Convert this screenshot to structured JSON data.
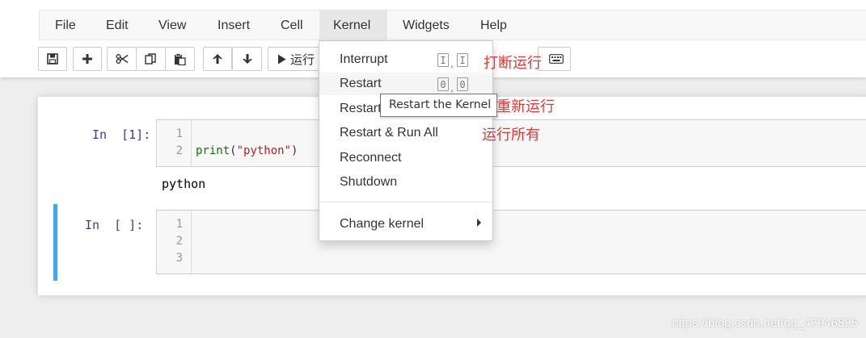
{
  "menubar": {
    "items": [
      {
        "label": "File"
      },
      {
        "label": "Edit"
      },
      {
        "label": "View"
      },
      {
        "label": "Insert"
      },
      {
        "label": "Cell"
      },
      {
        "label": "Kernel"
      },
      {
        "label": "Widgets"
      },
      {
        "label": "Help"
      }
    ],
    "active": "Kernel"
  },
  "toolbar": {
    "buttons": [
      {
        "icon": "save-icon"
      },
      {
        "icon": "plus-icon"
      },
      {
        "icon": "cut-icon"
      },
      {
        "icon": "copy-icon"
      },
      {
        "icon": "paste-icon"
      },
      {
        "icon": "arrow-up-icon"
      },
      {
        "icon": "arrow-down-icon"
      },
      {
        "icon": "run-icon",
        "label": "运行"
      },
      {
        "icon": "keyboard-icon"
      }
    ]
  },
  "cells": [
    {
      "prompt": "In  [1]:",
      "line_numbers": [
        "1",
        "2"
      ],
      "code_lines": [
        "",
        "print(\"python\")"
      ],
      "output": "python"
    },
    {
      "prompt": "In  [ ]:",
      "line_numbers": [
        "1",
        "2",
        "3"
      ],
      "code_lines": [
        "",
        "",
        ""
      ],
      "selected": true
    }
  ],
  "kernel_menu": {
    "items": [
      {
        "label": "Interrupt",
        "shortcut": [
          "I",
          "I"
        ]
      },
      {
        "label": "Restart",
        "shortcut": [
          "0",
          "0"
        ],
        "hovered": true
      },
      {
        "label": "Restart"
      },
      {
        "label": "Restart & Run All"
      },
      {
        "label": "Reconnect"
      },
      {
        "label": "Shutdown"
      },
      {
        "label": "Change kernel",
        "has_submenu": true
      }
    ],
    "shortcut_separator": ","
  },
  "tooltip": {
    "text": "Restart the Kernel"
  },
  "annotations": {
    "interrupt": "打断运行",
    "restart": "重新运行",
    "run_all": "运行所有"
  },
  "watermark": "https://blog.csdn.net/qq_47946825",
  "colors": {
    "annotation": "#e53935",
    "prompt": "#303f9f",
    "selected_bar": "#42a5f5",
    "menubar_bg": "#f8f8f8"
  }
}
